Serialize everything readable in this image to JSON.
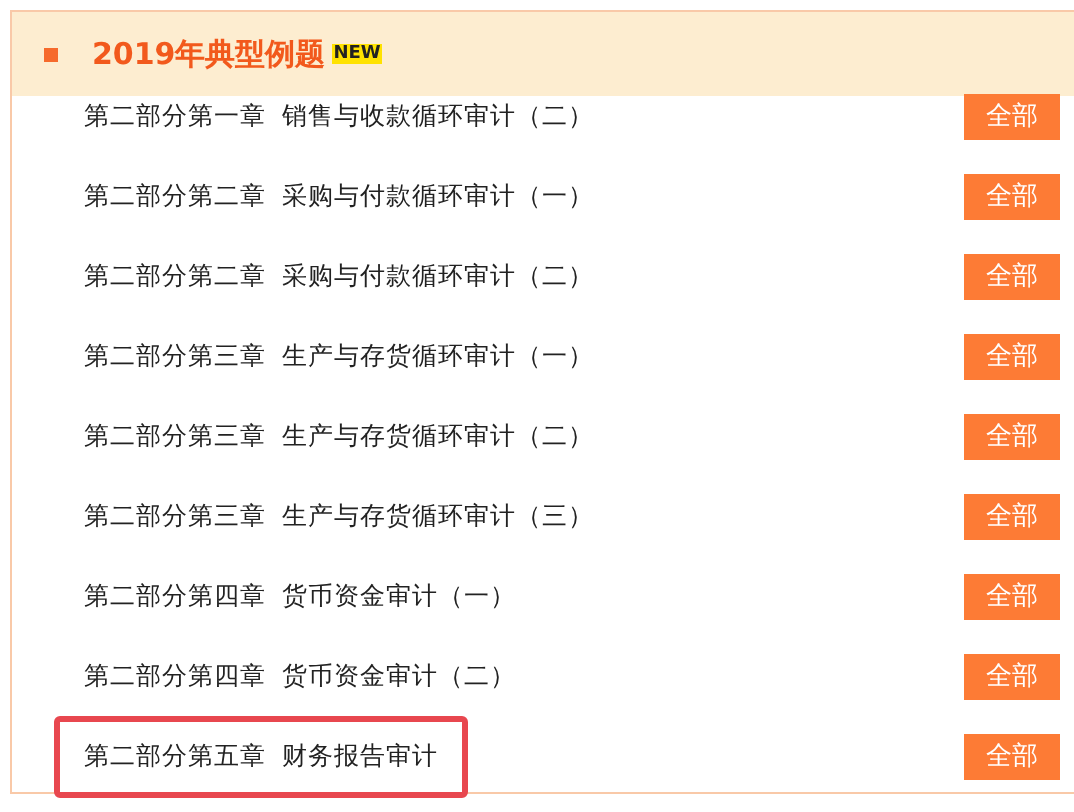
{
  "header": {
    "title": "2019年典型例题",
    "badge": "NEW"
  },
  "chapters": [
    {
      "title": "第二部分第一章  销售与收款循环审计（二）",
      "button": "全部",
      "highlighted": false
    },
    {
      "title": "第二部分第二章  采购与付款循环审计（一）",
      "button": "全部",
      "highlighted": false
    },
    {
      "title": "第二部分第二章  采购与付款循环审计（二）",
      "button": "全部",
      "highlighted": false
    },
    {
      "title": "第二部分第三章  生产与存货循环审计（一）",
      "button": "全部",
      "highlighted": false
    },
    {
      "title": "第二部分第三章  生产与存货循环审计（二）",
      "button": "全部",
      "highlighted": false
    },
    {
      "title": "第二部分第三章  生产与存货循环审计（三）",
      "button": "全部",
      "highlighted": false
    },
    {
      "title": "第二部分第四章  货币资金审计（一）",
      "button": "全部",
      "highlighted": false
    },
    {
      "title": "第二部分第四章  货币资金审计（二）",
      "button": "全部",
      "highlighted": false
    },
    {
      "title": "第二部分第五章  财务报告审计",
      "button": "全部",
      "highlighted": true
    }
  ]
}
